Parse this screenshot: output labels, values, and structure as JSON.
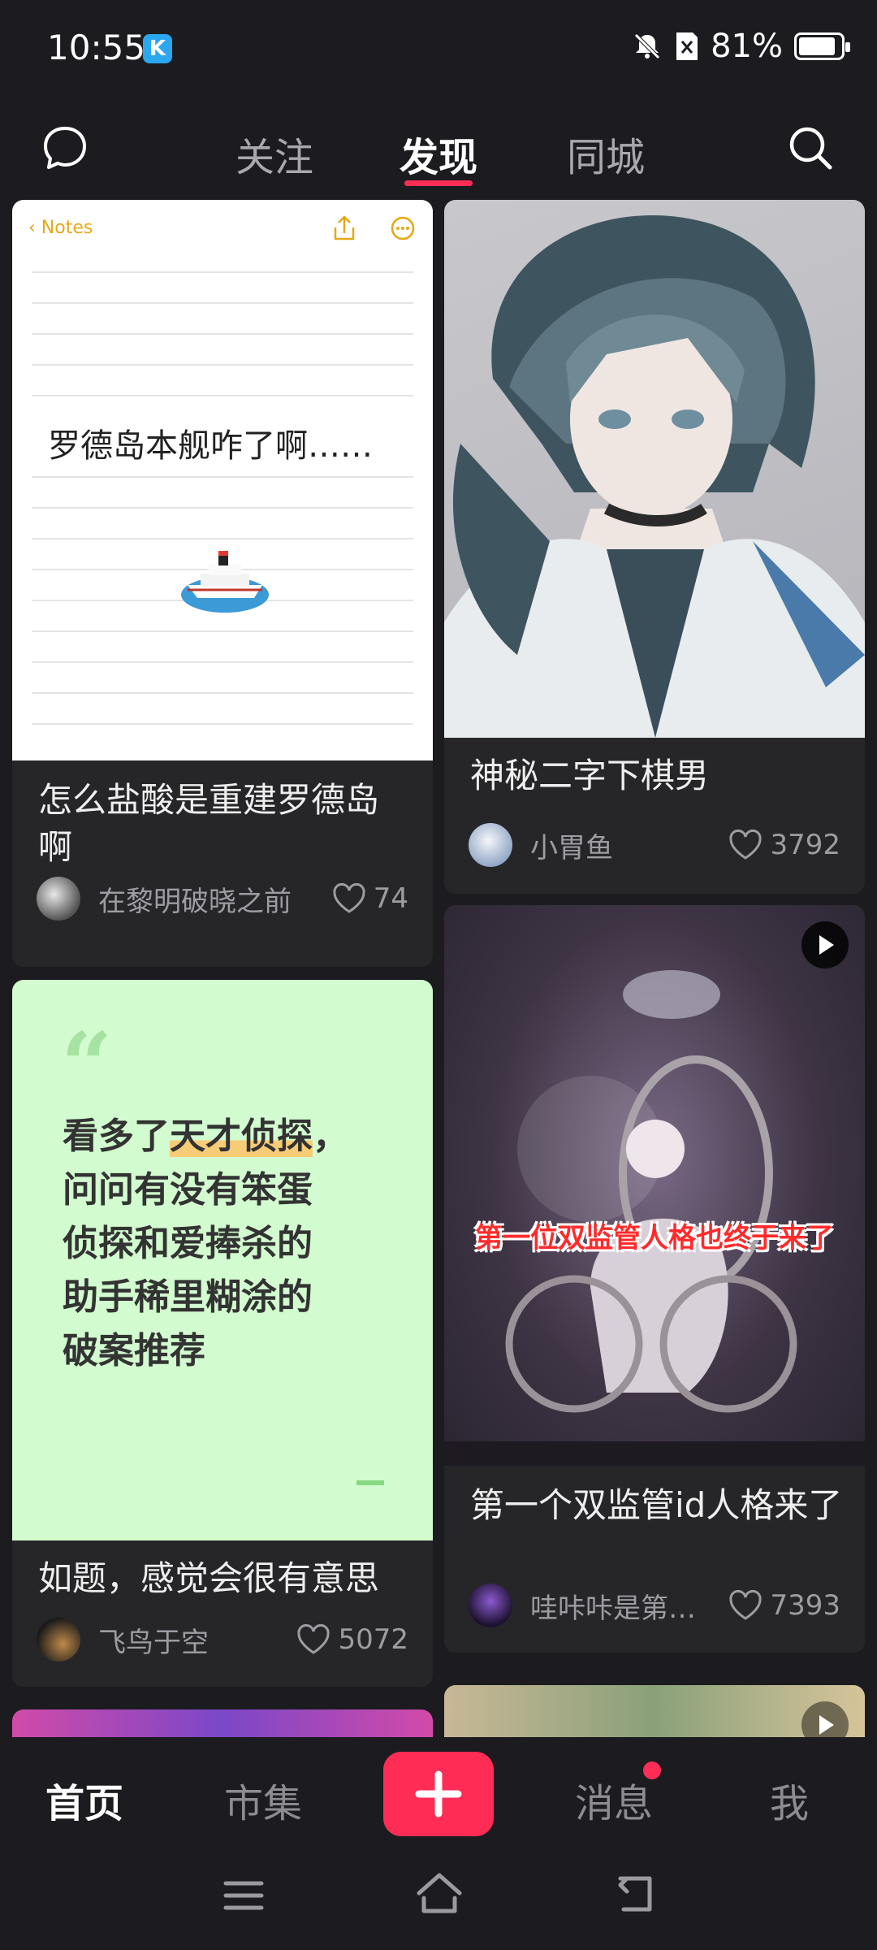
{
  "status": {
    "time": "10:55",
    "app_badge": "K",
    "battery": "81%"
  },
  "topnav": {
    "tabs": [
      "关注",
      "发现",
      "同城"
    ]
  },
  "cards": [
    {
      "title": "怎么盐酸是重建罗德岛啊",
      "author": "在黎明破晓之前",
      "likes": "74",
      "cover": {
        "app_back": "Notes",
        "note_text": "罗德岛本舰咋了啊……"
      }
    },
    {
      "title": "神秘二字下棋男",
      "author": "小胃鱼",
      "likes": "3792"
    },
    {
      "title": "如题，感觉会很有意思",
      "author": "飞鸟于空",
      "likes": "5072",
      "cover": {
        "quote_before": "看多了",
        "quote_highlight": "天才侦探",
        "quote_after": "，",
        "quote_lines": [
          "问问有没有笨蛋",
          "侦探和爱捧杀的",
          "助手稀里糊涂的",
          "破案推荐"
        ]
      }
    },
    {
      "title": "第一个双监管id人格来了",
      "author": "哇咔咔是第…",
      "likes": "7393",
      "cover": {
        "caption": "第一位双监管人格也终于来了"
      }
    }
  ],
  "bottomnav": {
    "home": "首页",
    "market": "市集",
    "messages": "消息",
    "me": "我"
  },
  "colors": {
    "accent": "#ff2c55",
    "background": "#1c1c20",
    "card": "#262629"
  }
}
